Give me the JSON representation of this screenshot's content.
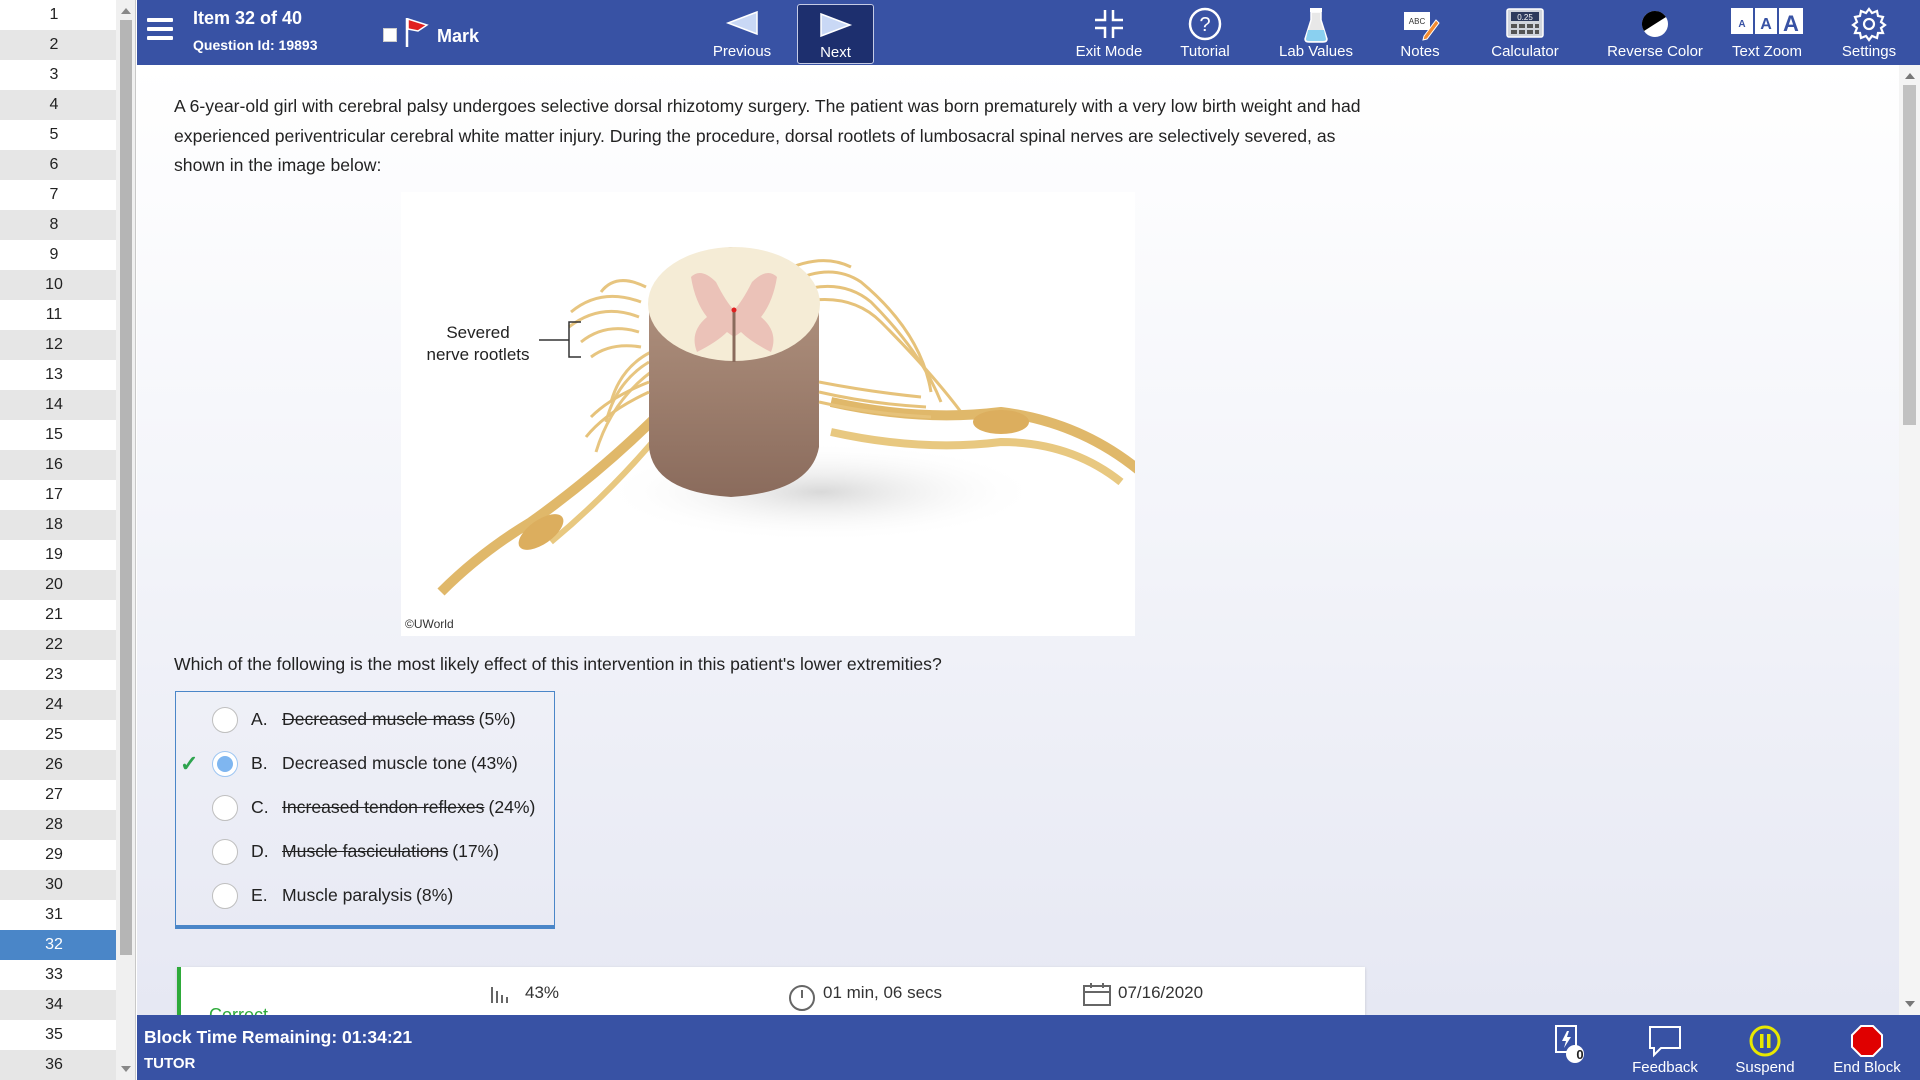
{
  "nav": {
    "items": [
      "1",
      "2",
      "3",
      "4",
      "5",
      "6",
      "7",
      "8",
      "9",
      "10",
      "11",
      "12",
      "13",
      "14",
      "15",
      "16",
      "17",
      "18",
      "19",
      "20",
      "21",
      "22",
      "23",
      "24",
      "25",
      "26",
      "27",
      "28",
      "29",
      "30",
      "31",
      "32",
      "33",
      "34",
      "35",
      "36"
    ],
    "current": "32"
  },
  "topbar": {
    "item_title": "Item 32 of 40",
    "question_id": "Question Id: 19893",
    "mark_label": "Mark",
    "previous_label": "Previous",
    "next_label": "Next",
    "exit_label": "Exit Mode",
    "tutorial_label": "Tutorial",
    "lab_label": "Lab Values",
    "notes_label": "Notes",
    "calculator_label": "Calculator",
    "calculator_display": "0.25",
    "reverse_label": "Reverse Color",
    "zoom_label": "Text Zoom",
    "settings_label": "Settings"
  },
  "stem": {
    "text": "A 6-year-old girl with cerebral palsy undergoes selective dorsal rhizotomy surgery.  The patient was born prematurely with a very low birth weight and had experienced periventricular cerebral white matter injury.  During the procedure, dorsal rootlets of lumbosacral spinal nerves are selectively severed, as shown in the image below:"
  },
  "figure": {
    "label_line1": "Severed",
    "label_line2": "nerve rootlets",
    "copyright": "©UWorld"
  },
  "question": {
    "text": "Which of the following is the most likely effect of this intervention in this patient's lower extremities?"
  },
  "choices": [
    {
      "letter": "A.",
      "text": "Decreased muscle mass",
      "pct": "(5%)",
      "struck": true,
      "selected": false,
      "correct": false
    },
    {
      "letter": "B.",
      "text": "Decreased muscle tone",
      "pct": "(43%)",
      "struck": false,
      "selected": true,
      "correct": true
    },
    {
      "letter": "C.",
      "text": "Increased tendon reflexes",
      "pct": "(24%)",
      "struck": true,
      "selected": false,
      "correct": false
    },
    {
      "letter": "D.",
      "text": "Muscle fasciculations",
      "pct": "(17%)",
      "struck": true,
      "selected": false,
      "correct": false
    },
    {
      "letter": "E.",
      "text": "Muscle paralysis",
      "pct": "(8%)",
      "struck": false,
      "selected": false,
      "correct": false
    }
  ],
  "stats": {
    "result": "Correct",
    "percent": "43%",
    "time": "01 min, 06 secs",
    "date": "07/16/2020"
  },
  "bottombar": {
    "block_time": "Block Time Remaining: 01:34:21",
    "mode": "TUTOR",
    "flash_count": "0",
    "feedback_label": "Feedback",
    "suspend_label": "Suspend",
    "end_block_label": "End Block"
  },
  "colors": {
    "bar": "#3852a4",
    "accent": "#4a86c8",
    "correct": "#2eaa3a",
    "end_block": "#e00000",
    "suspend": "#e8e800"
  }
}
